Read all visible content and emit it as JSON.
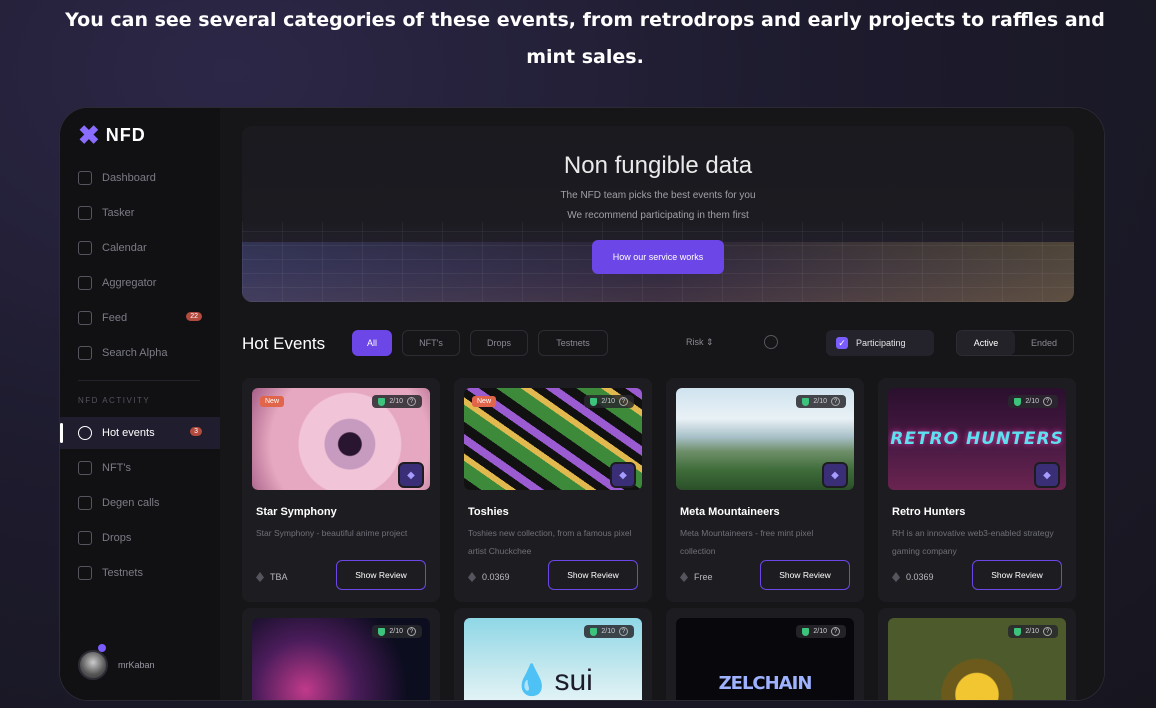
{
  "caption": "You can see several categories of these events, from retrodrops and early projects to raffles and mint sales.",
  "logo": {
    "text": "NFD"
  },
  "sidebar": {
    "items": [
      {
        "label": "Dashboard"
      },
      {
        "label": "Tasker"
      },
      {
        "label": "Calendar"
      },
      {
        "label": "Aggregator"
      },
      {
        "label": "Feed",
        "badge": "22"
      },
      {
        "label": "Search Alpha"
      }
    ],
    "section_title": "NFD ACTIVITY",
    "activity": [
      {
        "label": "Hot events",
        "badge": "3"
      },
      {
        "label": "NFT's"
      },
      {
        "label": "Degen calls"
      },
      {
        "label": "Drops"
      },
      {
        "label": "Testnets"
      }
    ],
    "user": "mrKaban"
  },
  "hero": {
    "title": "Non fungible data",
    "line1": "The NFD team picks the best events for you",
    "line2": "We recommend participating in them first",
    "button": "How our service works"
  },
  "toolbar": {
    "title": "Hot Events",
    "filters": [
      "All",
      "NFT's",
      "Drops",
      "Testnets"
    ],
    "risk": "Risk",
    "risk_arrow": "⇕",
    "participating": "Participating",
    "segments": [
      "Active",
      "Ended"
    ]
  },
  "cards": [
    {
      "badge": "New",
      "score": "2/10",
      "title": "Star Symphony",
      "desc": "Star Symphony - beautiful anime project",
      "price": "TBA",
      "button": "Show Review"
    },
    {
      "badge": "New",
      "score": "2/10",
      "title": "Toshies",
      "desc": "Toshies new collection, from a famous pixel artist Chuckchee",
      "price": "0.0369",
      "button": "Show Review"
    },
    {
      "score": "2/10",
      "title": "Meta Mountaineers",
      "desc": "Meta Mountaineers - free mint pixel collection",
      "price": "Free",
      "button": "Show Review"
    },
    {
      "score": "2/10",
      "title": "Retro Hunters",
      "desc": "RH is an innovative web3-enabled strategy gaming company",
      "price": "0.0369",
      "button": "Show Review",
      "art": "RETRO HUNTERS"
    }
  ],
  "cards_row2": [
    {
      "score": "2/10"
    },
    {
      "score": "2/10",
      "art": "sui"
    },
    {
      "score": "2/10",
      "art": "ZELCHAIN"
    },
    {
      "score": "2/10"
    }
  ],
  "colors": {
    "accent": "#6c46e6",
    "new_badge": "#e0654a",
    "score_shield": "#3cc47c"
  }
}
